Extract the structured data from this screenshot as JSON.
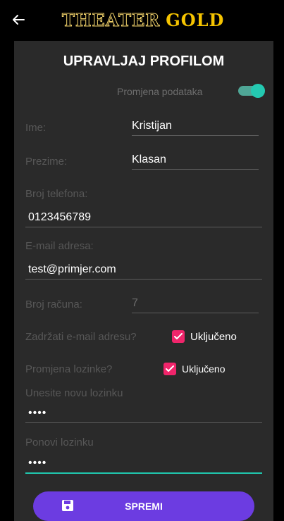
{
  "appbar": {
    "brand_part1": "THEATER",
    "brand_part2": "GOLD",
    "back_icon": "arrow-left-icon"
  },
  "screen": {
    "title": "UPRAVLJAJ PROFILOM",
    "edit_toggle": {
      "label": "Promjena podataka",
      "on": true
    }
  },
  "form": {
    "ime": {
      "label": "Ime:",
      "value": "Kristijan"
    },
    "prezime": {
      "label": "Prezime:",
      "value": "Klasan"
    },
    "telefon": {
      "label": "Broj telefona:",
      "value": "0123456789"
    },
    "email": {
      "label": "E-mail adresa:",
      "value": "test@primjer.com"
    },
    "racun": {
      "label": "Broj računa:",
      "value": "7"
    },
    "zadrzati_email": {
      "label": "Zadržati e-mail adresu?",
      "checkbox_text": "Uključeno",
      "checked": true
    },
    "promjena_lozinke": {
      "label": "Promjena lozinke?",
      "checkbox_text": "Uključeno",
      "checked": true
    },
    "nova_lozinka": {
      "label": "Unesite novu lozinku",
      "value": "••••"
    },
    "ponovi_lozinku": {
      "label": "Ponovi lozinku",
      "value": "••••"
    }
  },
  "actions": {
    "save_label": "SPREMI",
    "save_icon": "floppy-disk-icon"
  },
  "colors": {
    "accent_teal": "#24c9b1",
    "checkbox_pink": "#f0256b",
    "button_purple": "#6c3ce1",
    "brand_gold": "#f6c400"
  }
}
